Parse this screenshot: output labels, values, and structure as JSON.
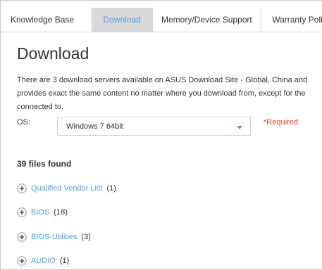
{
  "tabs": [
    {
      "label": "Knowledge Base",
      "active": false
    },
    {
      "label": "Download",
      "active": true
    },
    {
      "label": "Memory/Device Support",
      "active": false
    },
    {
      "label": "Warranty Poli",
      "active": false
    }
  ],
  "page": {
    "title": "Download",
    "description_lines": [
      "There are 3 download servers available on ASUS Download Site - Global, China and",
      "provides exact the same content no matter where you download from, except for the",
      "connected to."
    ]
  },
  "os": {
    "label": "OS:",
    "selected": "Windows 7 64bit",
    "required_note": "*Required"
  },
  "results": {
    "files_found": "39 files found",
    "categories": [
      {
        "name": "Qualified Vendor List",
        "count": "(1)"
      },
      {
        "name": "BIOS",
        "count": "(18)"
      },
      {
        "name": "BIOS-Utilities",
        "count": "(3)"
      },
      {
        "name": "AUDIO",
        "count": "(1)"
      }
    ]
  },
  "colors": {
    "accent": "#4aa3df",
    "required": "#e03c31",
    "active_tab_bg": "#d9d9d9"
  }
}
